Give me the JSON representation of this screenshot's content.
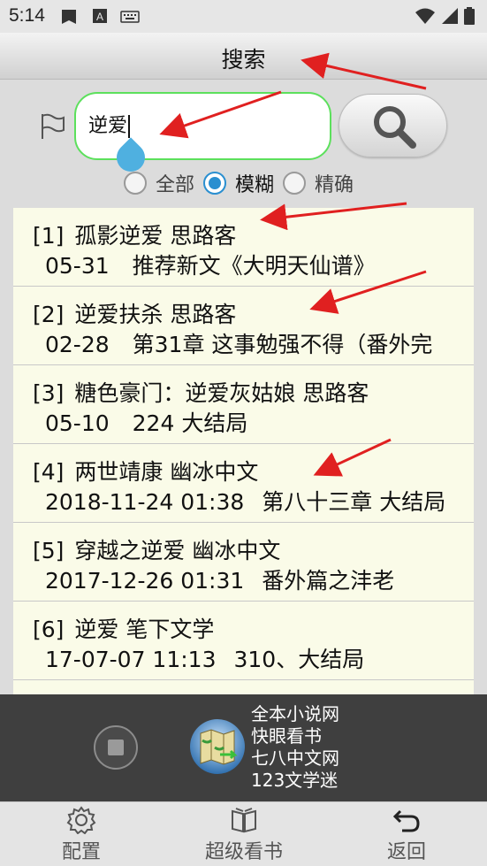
{
  "status_bar": {
    "time": "5:14"
  },
  "title_bar": {
    "title": "搜索"
  },
  "search": {
    "value": "逆爱",
    "options": [
      {
        "label": "全部",
        "checked": false
      },
      {
        "label": "模糊",
        "checked": true
      },
      {
        "label": "精确",
        "checked": false
      }
    ]
  },
  "results": [
    {
      "index": "[1]",
      "title": "孤影逆爱  思路客",
      "date": "05-31",
      "latest": "推荐新文《大明天仙谱》"
    },
    {
      "index": "[2]",
      "title": "逆爱扶杀  思路客",
      "date": "02-28",
      "latest": "第31章 这事勉强不得（番外完"
    },
    {
      "index": "[3]",
      "title": "糖色豪门：逆爱灰姑娘  思路客",
      "date": "05-10",
      "latest": "224  大结局"
    },
    {
      "index": "[4]",
      "title": "两世靖康  幽冰中文",
      "date": "2018-11-24 01:38",
      "latest": "第八十三章  大结局"
    },
    {
      "index": "[5]",
      "title": "穿越之逆爱  幽冰中文",
      "date": "2017-12-26 01:31",
      "latest": "番外篇之沣老"
    },
    {
      "index": "[6]",
      "title": "逆爱  笔下文学",
      "date": "17-07-07 11:13",
      "latest": "310、大结局"
    }
  ],
  "player": {
    "sites": [
      "全本小说网",
      "快眼看书",
      "七八中文网",
      "123文学迷"
    ]
  },
  "bottom_nav": [
    {
      "label": "配置",
      "icon": "gear-icon"
    },
    {
      "label": "超级看书",
      "icon": "book-icon"
    },
    {
      "label": "返回",
      "icon": "back-arrow-icon"
    }
  ],
  "colors": {
    "accent": "#2a8fd0",
    "input_border": "#5ce05c",
    "list_bg": "#fafbe8",
    "annotation": "#e02020"
  }
}
